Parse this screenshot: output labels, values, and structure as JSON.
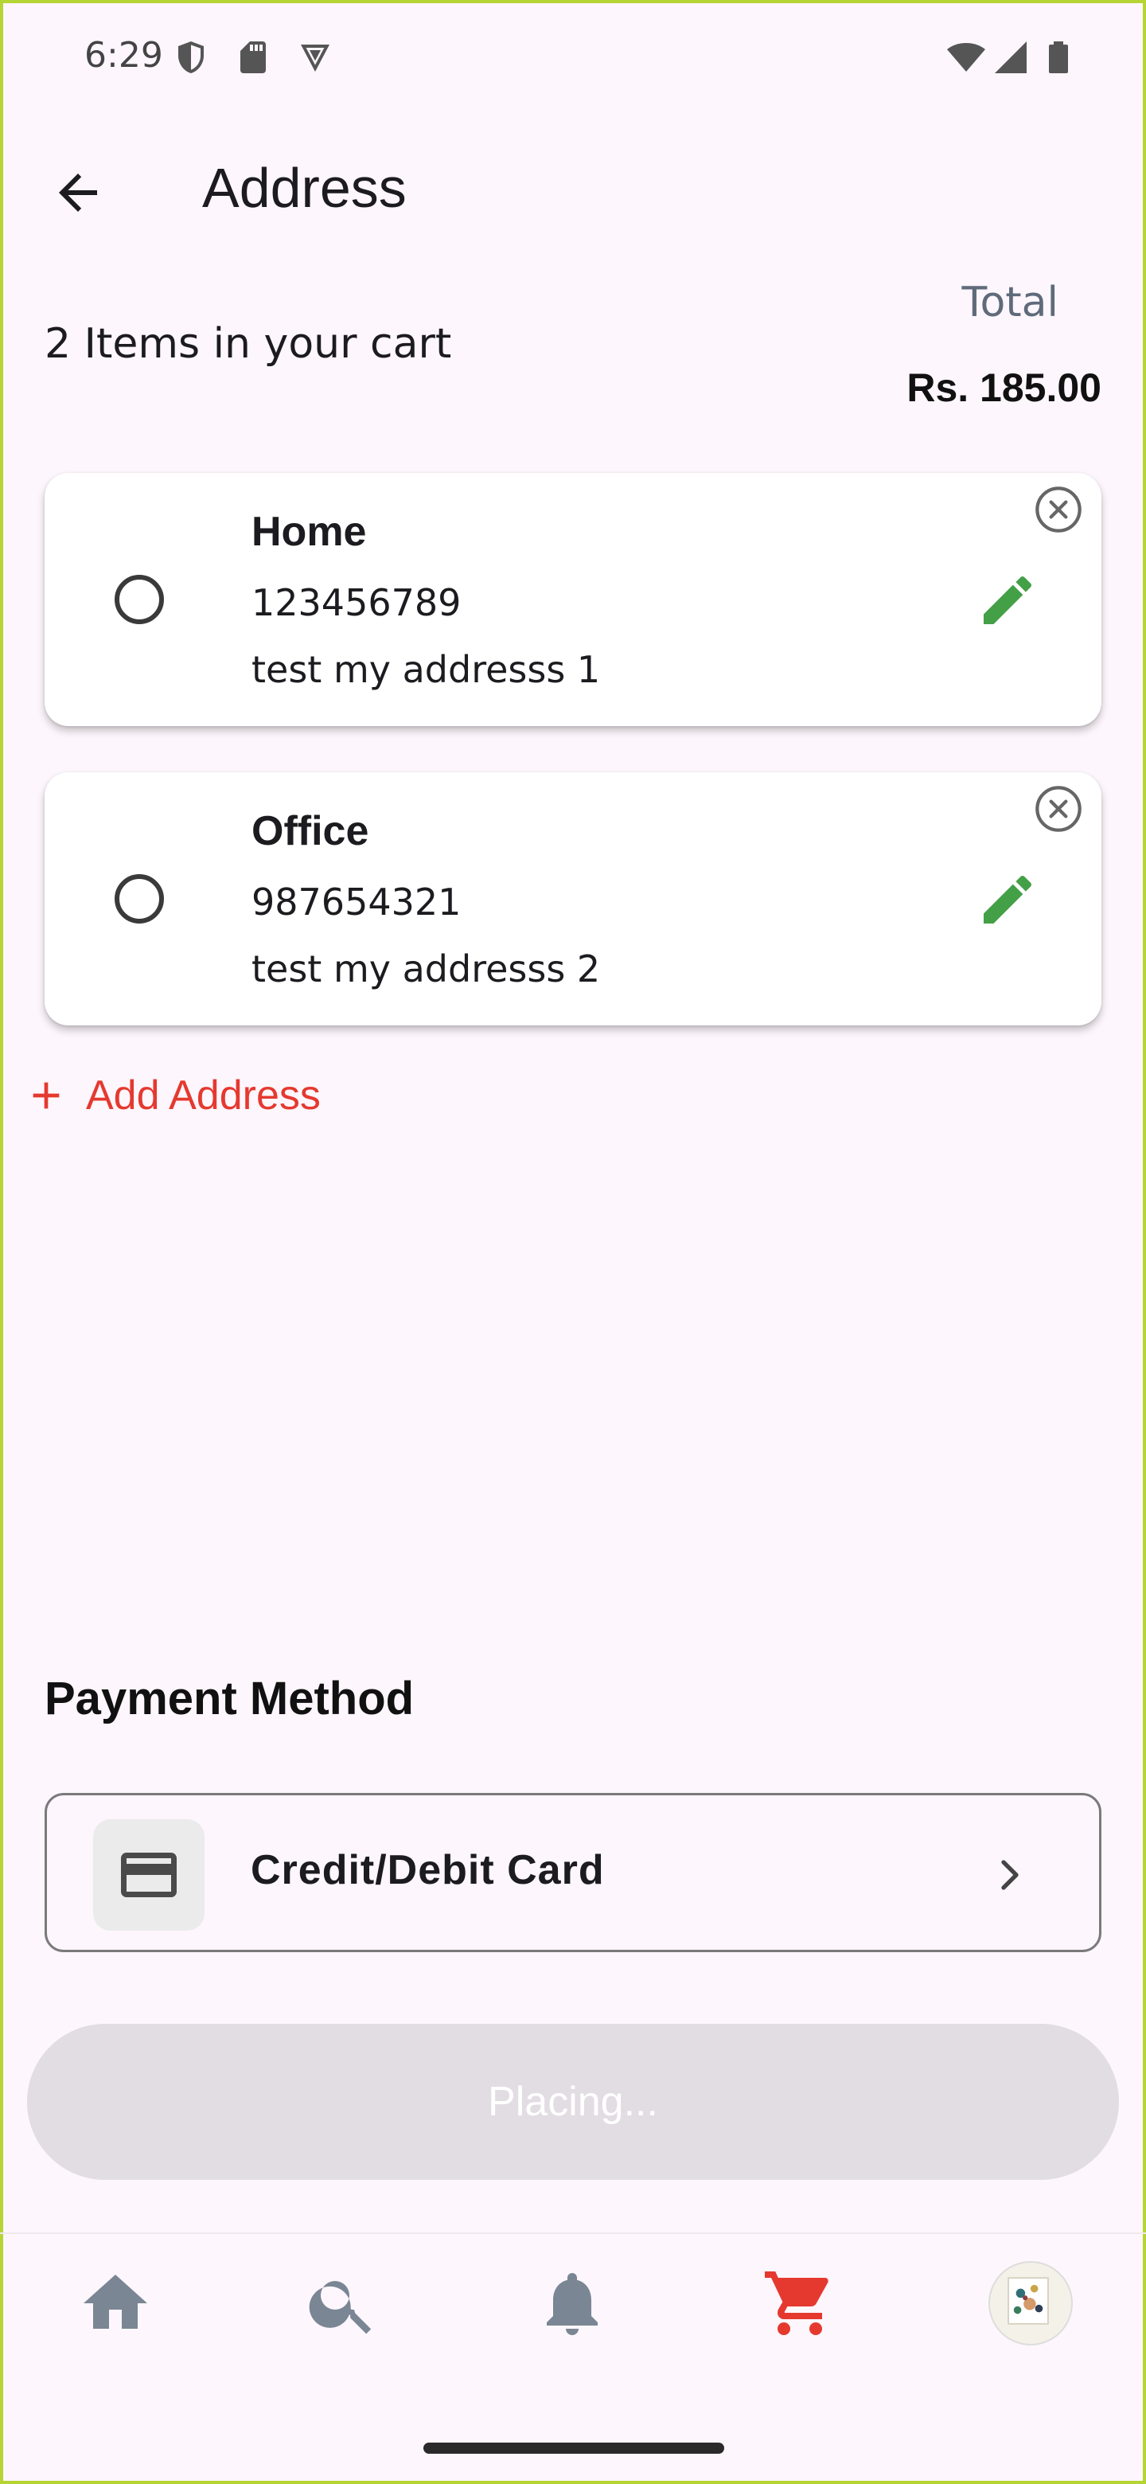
{
  "status_bar": {
    "time": "6:29",
    "icons": [
      "shield-icon",
      "sd-card-icon",
      "vpn-icon",
      "wifi-icon",
      "signal-icon",
      "battery-icon"
    ]
  },
  "header": {
    "title": "Address",
    "back_icon": "arrow-back-icon"
  },
  "summary": {
    "items_text": "2 Items in your cart",
    "total_label": "Total",
    "total_value": "Rs. 185.00"
  },
  "addresses": [
    {
      "name": "Home",
      "phone": "123456789",
      "line": "test my addresss 1",
      "selected": false
    },
    {
      "name": "Office",
      "phone": "987654321",
      "line": "test my addresss 2",
      "selected": false
    }
  ],
  "add_address": {
    "label": "Add Address"
  },
  "payment": {
    "heading": "Payment Method",
    "option_label": "Credit/Debit Card"
  },
  "place_button": {
    "label": "Placing..."
  },
  "bottom_nav": {
    "items": [
      "home-icon",
      "search-icon",
      "bell-icon",
      "cart-icon",
      "avatar"
    ],
    "active": "cart-icon"
  },
  "colors": {
    "background": "#FDF6FC",
    "accent_red": "#E5392F",
    "edit_green": "#43A047",
    "nav_gray": "#7A8694",
    "button_disabled": "#E2DCE3"
  }
}
